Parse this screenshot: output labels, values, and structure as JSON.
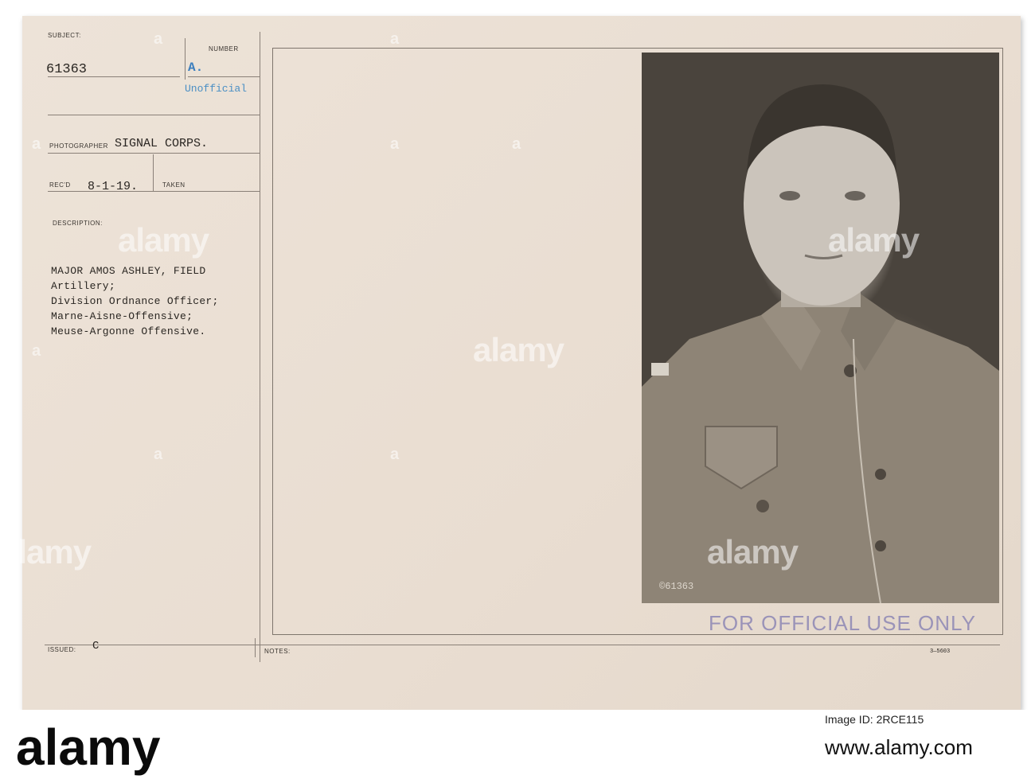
{
  "card": {
    "labels": {
      "subject": "SUBJECT:",
      "number": "NUMBER",
      "photographer": "PHOTOGRAPHER",
      "recd": "REC'D",
      "taken": "TAKEN",
      "description": "DESCRIPTION:",
      "issued": "ISSUED:",
      "notes": "NOTES:"
    },
    "subject_number": "61363",
    "number_value": "A.",
    "unofficial_stamp": "Unofficial",
    "photographer": "SIGNAL CORPS.",
    "recd_date": "8-1-19.",
    "description_lines": [
      "MAJOR AMOS ASHLEY, FIELD",
      "Artillery;",
      "Division Ordnance Officer;",
      "Marne-Aisne-Offensive;",
      "Meuse-Argonne Offensive."
    ],
    "issued_value": "C",
    "photo_number": "©61363",
    "official_stamp": "FOR OFFICIAL USE ONLY",
    "form_code": "3—5603"
  },
  "watermark": {
    "text": "alamy",
    "symbol": "a"
  },
  "footer": {
    "logo": "alamy",
    "image_id": "Image ID: 2RCE115",
    "site": "www.alamy.com"
  },
  "colors": {
    "card_background": "#ebe1d6",
    "typewriter_ink": "#2a2622",
    "stamp_blue": "#4a8fc4",
    "official_stamp": "#9a93b8"
  }
}
